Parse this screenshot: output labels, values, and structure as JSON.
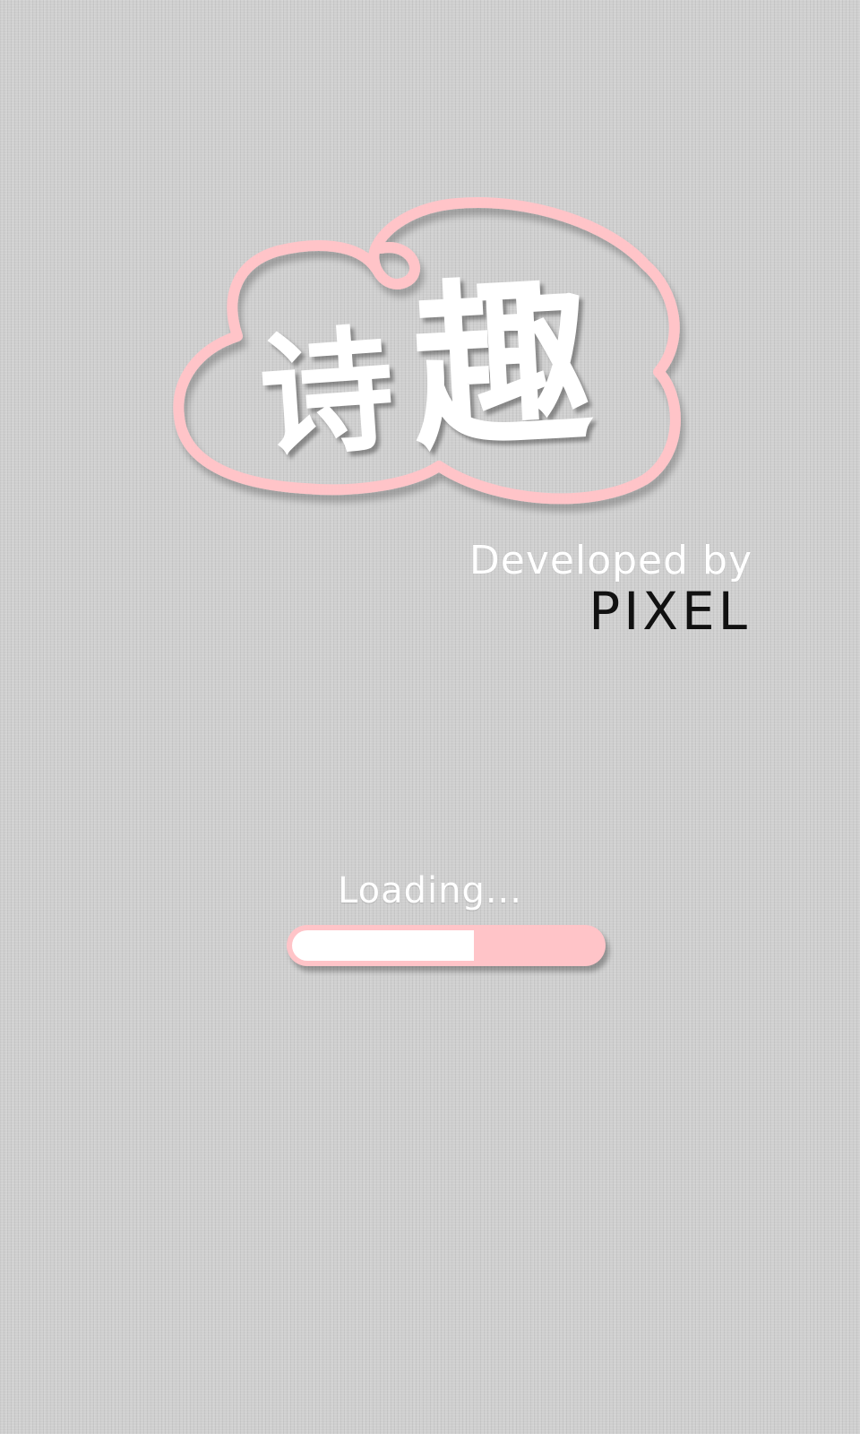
{
  "app": {
    "title": "诗趣"
  },
  "logo": {
    "char_1": "诗",
    "char_2": "趣",
    "cloud_color": "#ffc4c8",
    "text_color": "#ffffff"
  },
  "credits": {
    "developed_by": "Developed by",
    "developer": "PIXEL"
  },
  "loading": {
    "label": "Loading...",
    "progress": 0.59,
    "track_color": "#ffc4c8",
    "fill_color": "#ffffff"
  },
  "background": {
    "color": "#cfcfcf"
  }
}
